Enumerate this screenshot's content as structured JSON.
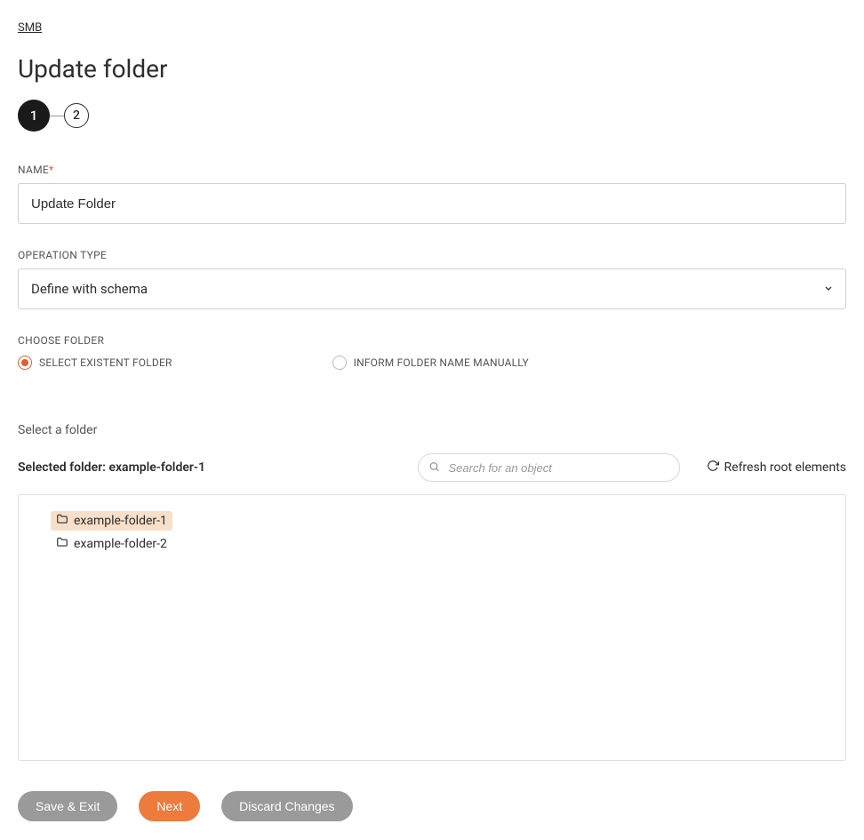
{
  "breadcrumb": "SMB",
  "page_title": "Update folder",
  "stepper": {
    "current": "1",
    "next": "2"
  },
  "fields": {
    "name_label": "NAME",
    "name_value": "Update Folder",
    "operation_label": "OPERATION TYPE",
    "operation_value": "Define with schema",
    "choose_label": "CHOOSE FOLDER"
  },
  "radios": {
    "select_existent": "SELECT EXISTENT FOLDER",
    "inform_manually": "INFORM FOLDER NAME MANUALLY"
  },
  "folder_section": {
    "subheading": "Select a folder",
    "selected_prefix": "Selected folder: ",
    "selected_value": "example-folder-1",
    "search_placeholder": "Search for an object",
    "refresh_label": "Refresh root elements"
  },
  "tree": [
    {
      "name": "example-folder-1",
      "selected": true
    },
    {
      "name": "example-folder-2",
      "selected": false
    }
  ],
  "buttons": {
    "save_exit": "Save & Exit",
    "next": "Next",
    "discard": "Discard Changes"
  }
}
